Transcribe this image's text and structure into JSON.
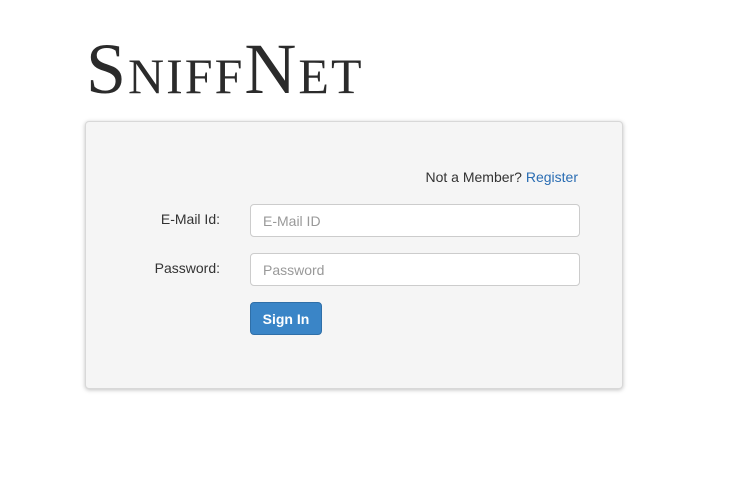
{
  "app": {
    "logo_text": "SniffNet"
  },
  "login": {
    "not_member_text": "Not a Member?",
    "register_link": "Register",
    "email_label": "E-Mail Id:",
    "email_placeholder": "E-Mail ID",
    "email_value": "",
    "password_label": "Password:",
    "password_placeholder": "Password",
    "password_value": "",
    "signin_label": "Sign In"
  },
  "colors": {
    "accent": "#3a85c7",
    "link": "#2a6db3",
    "card_background": "#f5f5f5"
  }
}
